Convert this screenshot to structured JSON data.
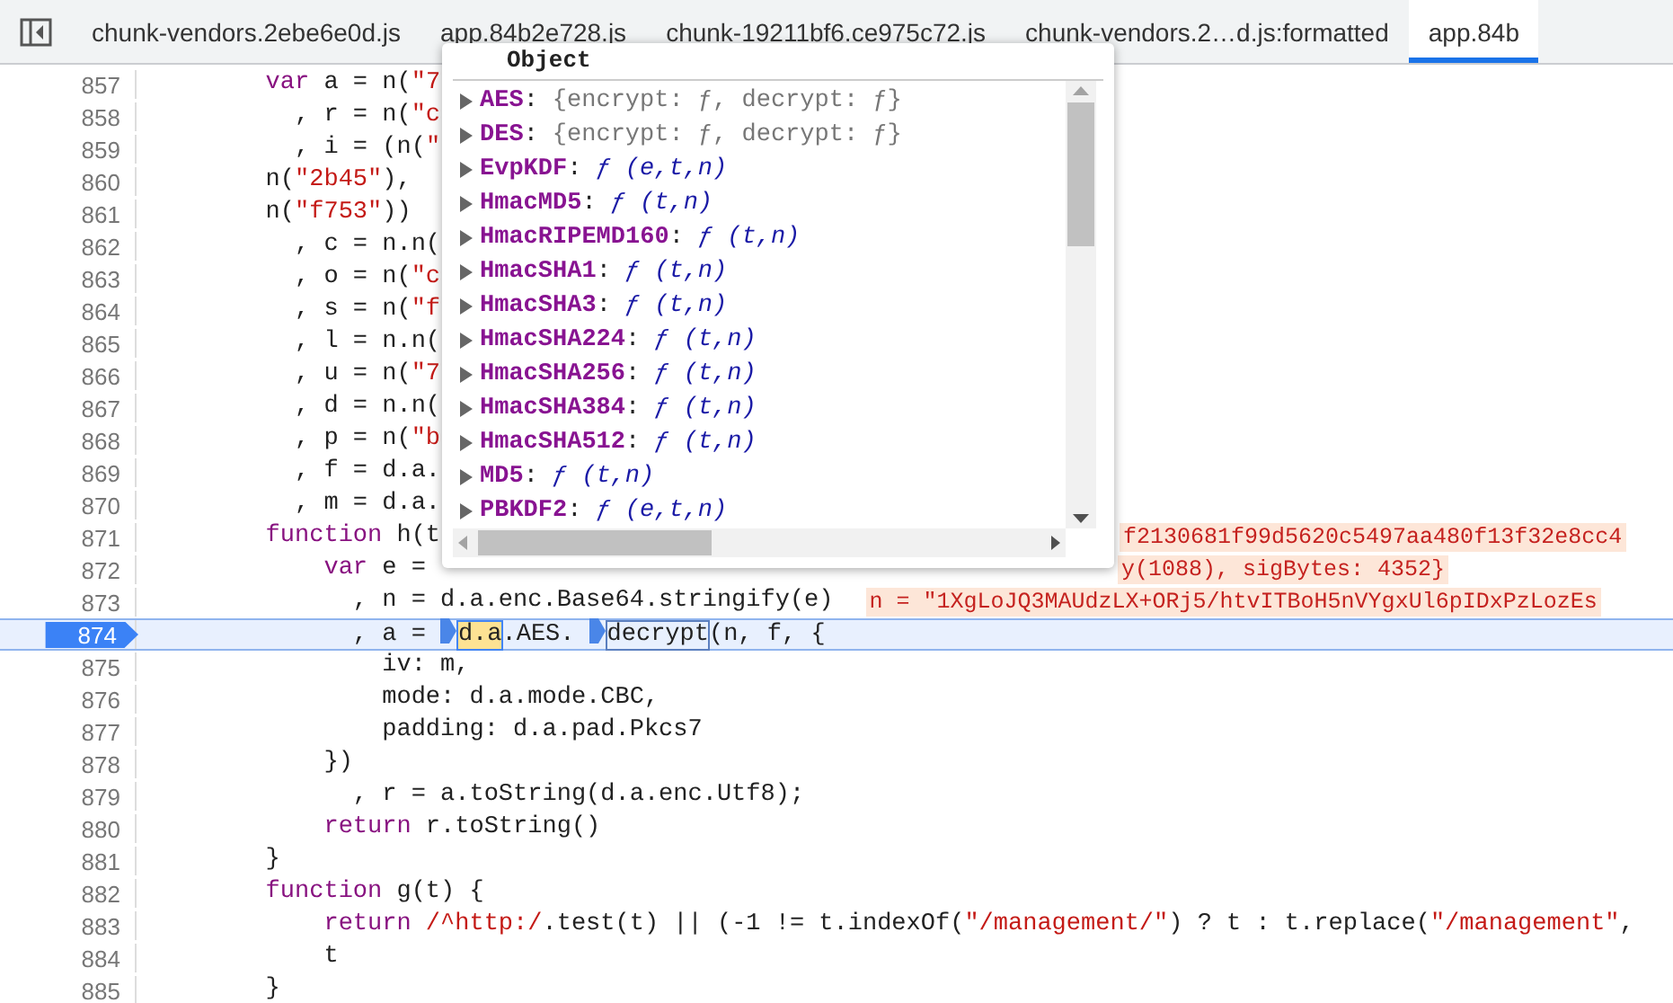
{
  "tabs": [
    {
      "label": "chunk-vendors.2ebe6e0d.js",
      "selected": false
    },
    {
      "label": "app.84b2e728.js",
      "selected": false
    },
    {
      "label": "chunk-19211bf6.ce975c72.js",
      "selected": false
    },
    {
      "label": "chunk-vendors.2…d.js:formatted",
      "selected": false
    },
    {
      "label": "app.84b",
      "selected": true
    }
  ],
  "code_lines": [
    {
      "number": "857",
      "current": false,
      "segments": [
        {
          "t": "        var",
          "kind": "keyword"
        },
        {
          "t": " a = n("
        },
        {
          "t": "\"7",
          "kind": "string"
        }
      ]
    },
    {
      "number": "858",
      "current": false,
      "segments": [
        {
          "t": "          , r = n("
        },
        {
          "t": "\"c",
          "kind": "string"
        }
      ]
    },
    {
      "number": "859",
      "current": false,
      "segments": [
        {
          "t": "          , i = (n("
        },
        {
          "t": "\"",
          "kind": "string"
        }
      ]
    },
    {
      "number": "860",
      "current": false,
      "segments": [
        {
          "t": "        n("
        },
        {
          "t": "\"2b45\"",
          "kind": "string"
        },
        {
          "t": "),"
        }
      ]
    },
    {
      "number": "861",
      "current": false,
      "segments": [
        {
          "t": "        n("
        },
        {
          "t": "\"f753\"",
          "kind": "string"
        },
        {
          "t": "))"
        }
      ]
    },
    {
      "number": "862",
      "current": false,
      "segments": [
        {
          "t": "          , c = n.n("
        }
      ]
    },
    {
      "number": "863",
      "current": false,
      "segments": [
        {
          "t": "          , o = n("
        },
        {
          "t": "\"c",
          "kind": "string"
        }
      ]
    },
    {
      "number": "864",
      "current": false,
      "segments": [
        {
          "t": "          , s = n("
        },
        {
          "t": "\"f",
          "kind": "string"
        }
      ]
    },
    {
      "number": "865",
      "current": false,
      "segments": [
        {
          "t": "          , l = n.n("
        }
      ]
    },
    {
      "number": "866",
      "current": false,
      "segments": [
        {
          "t": "          , u = n("
        },
        {
          "t": "\"7",
          "kind": "string"
        }
      ]
    },
    {
      "number": "867",
      "current": false,
      "segments": [
        {
          "t": "          , d = n.n("
        }
      ]
    },
    {
      "number": "868",
      "current": false,
      "segments": [
        {
          "t": "          , p = n("
        },
        {
          "t": "\"b",
          "kind": "string"
        }
      ]
    },
    {
      "number": "869",
      "current": false,
      "segments": [
        {
          "t": "          , f = d.a."
        }
      ]
    },
    {
      "number": "870",
      "current": false,
      "segments": [
        {
          "t": "          , m = d.a."
        }
      ]
    },
    {
      "number": "871",
      "current": false,
      "covered": true,
      "segments": [
        {
          "t": "        function",
          "kind": "keyword"
        },
        {
          "t": " h(t"
        }
      ],
      "inline_value": "f2130681f99d5620c5497aa480f13f32e8cc4"
    },
    {
      "number": "872",
      "current": false,
      "covered": true,
      "segments": [
        {
          "t": "            var",
          "kind": "keyword"
        },
        {
          "t": " e ="
        }
      ],
      "inline_value": "y(1088), sigBytes: 4352}"
    },
    {
      "number": "873",
      "current": false,
      "segments": [
        {
          "t": "              , n = d.a.enc.Base64.stringify(e)"
        }
      ],
      "inline_value": "n = \"1XgLoJQ3MAUdzLX+ORj5/htvITBoH5nVYgxUl6pIDxPzLozEs"
    },
    {
      "number": "874",
      "current": true,
      "segments": [
        {
          "t": "              , a ="
        },
        {
          "kind": "marker"
        },
        {
          "t": "d.a",
          "kind": "highlight"
        },
        {
          "t": ".AES."
        },
        {
          "kind": "marker"
        },
        {
          "t": "decrypt",
          "kind": "boxed"
        },
        {
          "t": "(n, f, {"
        }
      ]
    },
    {
      "number": "875",
      "current": false,
      "segments": [
        {
          "t": "                iv: m,"
        }
      ]
    },
    {
      "number": "876",
      "current": false,
      "segments": [
        {
          "t": "                mode: d.a.mode.CBC,"
        }
      ]
    },
    {
      "number": "877",
      "current": false,
      "segments": [
        {
          "t": "                padding: d.a.pad.Pkcs7"
        }
      ]
    },
    {
      "number": "878",
      "current": false,
      "segments": [
        {
          "t": "            })"
        }
      ]
    },
    {
      "number": "879",
      "current": false,
      "segments": [
        {
          "t": "              , r = a.toString(d.a.enc.Utf8);"
        }
      ]
    },
    {
      "number": "880",
      "current": false,
      "segments": [
        {
          "t": "            return",
          "kind": "keyword"
        },
        {
          "t": " r.toString()"
        }
      ]
    },
    {
      "number": "881",
      "current": false,
      "segments": [
        {
          "t": "        }"
        }
      ]
    },
    {
      "number": "882",
      "current": false,
      "segments": [
        {
          "t": "        function",
          "kind": "keyword"
        },
        {
          "t": " g(t) {"
        }
      ]
    },
    {
      "number": "883",
      "current": false,
      "segments": [
        {
          "t": "            return",
          "kind": "keyword"
        },
        {
          "t": " /^http:/",
          "kind": "string"
        },
        {
          "t": ".test(t) || (-1 != t.indexOf("
        },
        {
          "t": "\"/management/\"",
          "kind": "string"
        },
        {
          "t": ") ? t : t.replace("
        },
        {
          "t": "\"/management\"",
          "kind": "string"
        },
        {
          "t": ","
        }
      ]
    },
    {
      "number": "884",
      "current": false,
      "segments": [
        {
          "t": "            t"
        }
      ]
    },
    {
      "number": "885",
      "current": false,
      "segments": [
        {
          "t": "        }"
        }
      ]
    }
  ],
  "popover": {
    "title": "Object",
    "entries": [
      {
        "name": "AES",
        "separator": ":",
        "kind": "object",
        "value": "{encrypt: ƒ, decrypt: ƒ}"
      },
      {
        "name": "DES",
        "separator": ":",
        "kind": "object",
        "value": "{encrypt: ƒ, decrypt: ƒ}"
      },
      {
        "name": "EvpKDF",
        "separator": ":",
        "kind": "function",
        "value": "ƒ (e,t,n)"
      },
      {
        "name": "HmacMD5",
        "separator": ":",
        "kind": "function",
        "value": "ƒ (t,n)"
      },
      {
        "name": "HmacRIPEMD160",
        "separator": ":",
        "kind": "function",
        "value": "ƒ (t,n)"
      },
      {
        "name": "HmacSHA1",
        "separator": ":",
        "kind": "function",
        "value": "ƒ (t,n)"
      },
      {
        "name": "HmacSHA3",
        "separator": ":",
        "kind": "function",
        "value": "ƒ (t,n)"
      },
      {
        "name": "HmacSHA224",
        "separator": ":",
        "kind": "function",
        "value": "ƒ (t,n)"
      },
      {
        "name": "HmacSHA256",
        "separator": ":",
        "kind": "function",
        "value": "ƒ (t,n)"
      },
      {
        "name": "HmacSHA384",
        "separator": ":",
        "kind": "function",
        "value": "ƒ (t,n)"
      },
      {
        "name": "HmacSHA512",
        "separator": ":",
        "kind": "function",
        "value": "ƒ (t,n)"
      },
      {
        "name": "MD5",
        "separator": ":",
        "kind": "function",
        "value": "ƒ (t,n)"
      },
      {
        "name": "PBKDF2",
        "separator": ":",
        "kind": "function",
        "value": "ƒ (e,t,n)"
      }
    ]
  }
}
